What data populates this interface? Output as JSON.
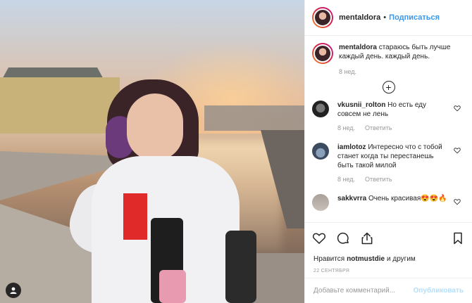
{
  "post": {
    "author": "mentaldora",
    "separator": "•",
    "follow_label": "Подписаться"
  },
  "caption": {
    "username": "mentaldora",
    "text": "стараюсь быть лучше каждый день. каждый день.",
    "age": "8 нед."
  },
  "comments": [
    {
      "username": "vkusnii_rolton",
      "text": "Но есть еду совсем не лень",
      "age": "8 нед.",
      "reply_label": "Ответить"
    },
    {
      "username": "iamlotoz",
      "text": "Интересно что с тобой станет когда ты перестанешь быть такой милой",
      "age": "8 нед.",
      "reply_label": "Ответить"
    },
    {
      "username": "sakkvrra",
      "text": "Очень красивая😍😍🔥"
    }
  ],
  "likes": {
    "prefix": "Нравится",
    "user": "notmustdie",
    "suffix": "и другим"
  },
  "date": "22 СЕНТЯБРЯ",
  "add_comment": {
    "placeholder": "Добавьте комментарий...",
    "publish_label": "Опубликовать"
  },
  "icons": {
    "heart": "heart-icon",
    "comment": "comment-icon",
    "share": "share-icon",
    "bookmark": "bookmark-icon",
    "load_more": "plus-circle-icon",
    "user_tag": "user-icon"
  },
  "colors": {
    "accent": "#3897f0",
    "publish_disabled": "#b2dffc",
    "muted": "#999999"
  }
}
